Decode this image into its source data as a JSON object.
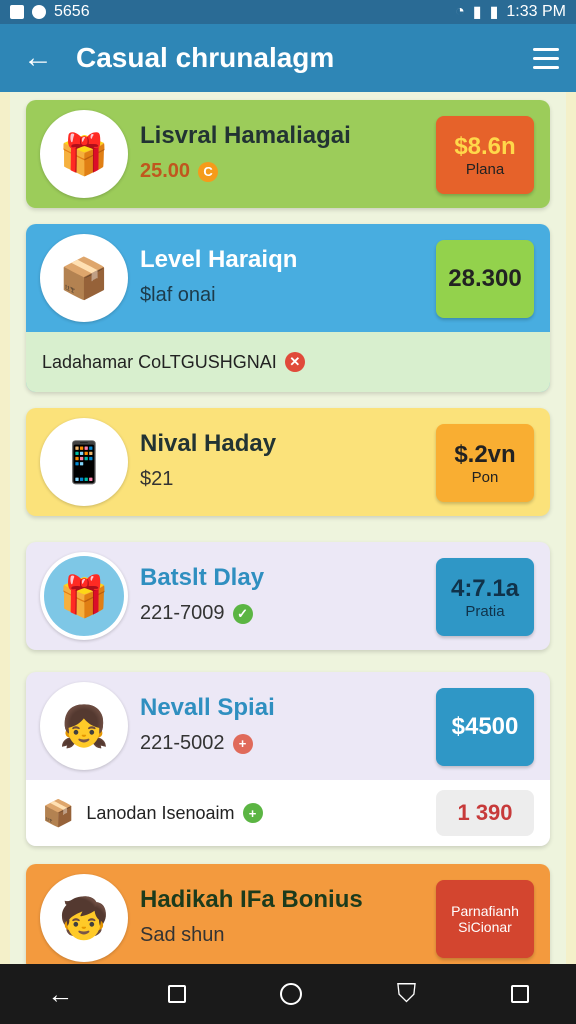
{
  "status_bar": {
    "left_text": "5656",
    "time": "1:33 PM"
  },
  "app_bar": {
    "back_icon": "back-arrow-icon",
    "title": "Casual chrunalagm",
    "menu_icon": "hamburger-menu-icon"
  },
  "cards": [
    {
      "name": "Lisvral Hamaliagai",
      "sub": "25.00",
      "sub_badge": "C",
      "price": "$8.6n",
      "price_label": "Plana",
      "avatar_icon": "boy-with-gift-box-icon",
      "colors": {
        "bg": "#9ccc5a",
        "pill": "#e6622a"
      }
    },
    {
      "name": "Level Haraiqn",
      "sub": "$laf onai",
      "price": "28.300",
      "price_label": "",
      "avatar_icon": "gift-box-icon",
      "colors": {
        "bg": "#48ade0",
        "pill": "#93d24c"
      },
      "strip": {
        "text": "Ladahamar CoLTGUSHGNAI",
        "badge": "✕",
        "bg": "#d8efce"
      }
    },
    {
      "name": "Nival Haday",
      "sub": "$21",
      "price": "$.2vn",
      "price_label": "Pon",
      "avatar_icon": "phone-shopping-icon",
      "colors": {
        "bg": "#fbe27a",
        "pill": "#f9ae32"
      }
    },
    {
      "name": "Batslt Dlay",
      "sub": "221-7009",
      "sub_badge": "✓",
      "price": "4:7.1a",
      "price_label": "Pratia",
      "avatar_icon": "gift-box-icon",
      "colors": {
        "bg": "#ece8f6",
        "pill": "#2f97c6"
      }
    },
    {
      "name": "Nevall Spiai",
      "sub": "221-5002",
      "sub_badge": "+",
      "price": "$4500",
      "price_label": "",
      "avatar_icon": "girl-avatar-icon",
      "colors": {
        "bg": "#ece8f6",
        "pill": "#2f97c6"
      },
      "strip": {
        "text": "Lanodan Isenoaim",
        "badge": "+",
        "bg": "#ffffff",
        "price": "1 390"
      }
    },
    {
      "name": "Hadikah IFa Bonius",
      "sub": "Sad shun",
      "price": "Parnafianh",
      "price_label": "SiCionar",
      "avatar_icon": "boy-avatar-icon",
      "colors": {
        "bg": "#f39a3e",
        "pill": "#d3452f"
      }
    }
  ],
  "nav_bar": {
    "items": [
      "back-icon",
      "recents-icon",
      "home-icon",
      "shield-icon",
      "square-icon"
    ]
  }
}
